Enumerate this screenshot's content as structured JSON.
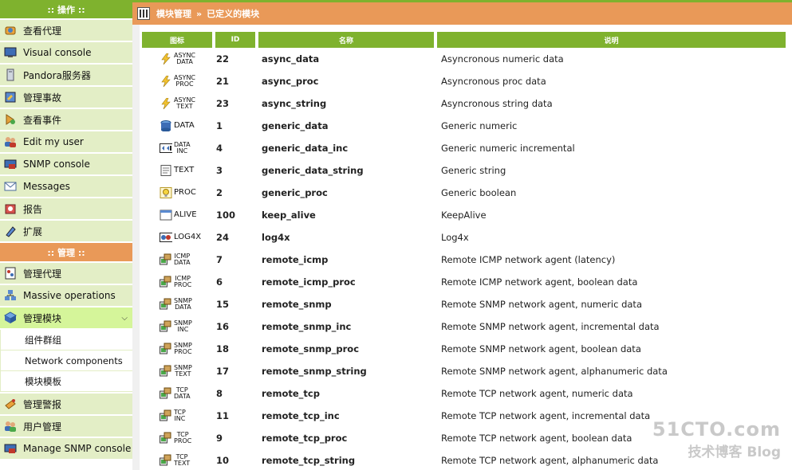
{
  "sidebar": {
    "operations_header": ":: 操作 ::",
    "operations": [
      {
        "label": "查看代理",
        "icon": "agents-icon"
      },
      {
        "label": "Visual console",
        "icon": "monitor-icon"
      },
      {
        "label": "Pandora服务器",
        "icon": "server-icon"
      },
      {
        "label": "管理事故",
        "icon": "incidents-icon"
      },
      {
        "label": "查看事件",
        "icon": "events-icon"
      },
      {
        "label": "Edit my user",
        "icon": "users-icon"
      },
      {
        "label": "SNMP console",
        "icon": "snmp-icon"
      },
      {
        "label": "Messages",
        "icon": "envelope-icon"
      },
      {
        "label": "报告",
        "icon": "report-icon"
      },
      {
        "label": "扩展",
        "icon": "extension-icon"
      }
    ],
    "admin_header": ":: 管理 ::",
    "admin": [
      {
        "label": "管理代理",
        "icon": "manage-agents-icon"
      },
      {
        "label": "Massive operations",
        "icon": "massive-operations-icon"
      },
      {
        "label": "管理模块",
        "icon": "modules-icon",
        "active": true
      },
      {
        "label": "管理警报",
        "icon": "alerts-icon"
      },
      {
        "label": "用户管理",
        "icon": "user-management-icon"
      },
      {
        "label": "Manage SNMP console",
        "icon": "snmp-manage-icon"
      }
    ],
    "modules_submenu": [
      "组件群组",
      "Network components",
      "模块模板"
    ]
  },
  "header": {
    "section": "模块管理",
    "separator": "»",
    "page": "已定义的模块"
  },
  "table": {
    "columns": [
      "图标",
      "ID",
      "名称",
      "说明"
    ],
    "rows": [
      {
        "icon": "lightning-icon",
        "tag": [
          "ASYNC",
          "DATA"
        ],
        "id": "22",
        "name": "async_data",
        "desc": "Asyncronous numeric data"
      },
      {
        "icon": "lightning-icon",
        "tag": [
          "ASYNC",
          "PROC"
        ],
        "id": "21",
        "name": "async_proc",
        "desc": "Asyncronous proc data"
      },
      {
        "icon": "lightning-icon",
        "tag": [
          "ASYNC",
          "TEXT"
        ],
        "id": "23",
        "name": "async_string",
        "desc": "Asyncronous string data"
      },
      {
        "icon": "database-icon",
        "tag": [
          "DATA"
        ],
        "id": "1",
        "name": "generic_data",
        "desc": "Generic numeric"
      },
      {
        "icon": "data-inc-icon",
        "tag": [
          "DATA",
          "INC"
        ],
        "id": "4",
        "name": "generic_data_inc",
        "desc": "Generic numeric incremental"
      },
      {
        "icon": "text-doc-icon",
        "tag": [
          "TEXT"
        ],
        "id": "3",
        "name": "generic_data_string",
        "desc": "Generic string"
      },
      {
        "icon": "lightbulb-icon",
        "tag": [
          "PROC"
        ],
        "id": "2",
        "name": "generic_proc",
        "desc": "Generic boolean"
      },
      {
        "icon": "window-icon",
        "tag": [
          "ALIVE"
        ],
        "id": "100",
        "name": "keep_alive",
        "desc": "KeepAlive"
      },
      {
        "icon": "log4x-icon",
        "tag": [
          "LOG4X"
        ],
        "id": "24",
        "name": "log4x",
        "desc": "Log4x"
      },
      {
        "icon": "network-icon",
        "tag": [
          "ICMP",
          "DATA"
        ],
        "id": "7",
        "name": "remote_icmp",
        "desc": "Remote ICMP network agent (latency)"
      },
      {
        "icon": "network-icon",
        "tag": [
          "ICMP",
          "PROC"
        ],
        "id": "6",
        "name": "remote_icmp_proc",
        "desc": "Remote ICMP network agent, boolean data"
      },
      {
        "icon": "network-icon",
        "tag": [
          "SNMP",
          "DATA"
        ],
        "id": "15",
        "name": "remote_snmp",
        "desc": "Remote SNMP network agent, numeric data"
      },
      {
        "icon": "network-icon",
        "tag": [
          "SNMP",
          "INC"
        ],
        "id": "16",
        "name": "remote_snmp_inc",
        "desc": "Remote SNMP network agent, incremental data"
      },
      {
        "icon": "network-icon",
        "tag": [
          "SNMP",
          "PROC"
        ],
        "id": "18",
        "name": "remote_snmp_proc",
        "desc": "Remote SNMP network agent, boolean data"
      },
      {
        "icon": "network-icon",
        "tag": [
          "SNMP",
          "TEXT"
        ],
        "id": "17",
        "name": "remote_snmp_string",
        "desc": "Remote SNMP network agent, alphanumeric data"
      },
      {
        "icon": "network-icon",
        "tag": [
          "TCP",
          "DATA"
        ],
        "id": "8",
        "name": "remote_tcp",
        "desc": "Remote TCP network agent, numeric data"
      },
      {
        "icon": "network-icon",
        "tag": [
          "TCP",
          "INC"
        ],
        "id": "11",
        "name": "remote_tcp_inc",
        "desc": "Remote TCP network agent, incremental data"
      },
      {
        "icon": "network-icon",
        "tag": [
          "TCP",
          "PROC"
        ],
        "id": "9",
        "name": "remote_tcp_proc",
        "desc": "Remote TCP network agent, boolean data"
      },
      {
        "icon": "network-icon",
        "tag": [
          "TCP",
          "TEXT"
        ],
        "id": "10",
        "name": "remote_tcp_string",
        "desc": "Remote TCP network agent, alphanumeric data"
      }
    ]
  },
  "watermark": {
    "line1": "51CTO.com",
    "line2": "技术博客  Blog"
  },
  "colors": {
    "green": "#7fb22e",
    "orange": "#e99958",
    "nav_bg": "#e3eec6",
    "active_bg": "#d5f59a"
  }
}
